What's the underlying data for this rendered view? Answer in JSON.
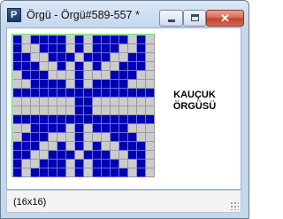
{
  "window": {
    "title": "Örgü - Örgü#589-557 *",
    "app_icon_letter": "P",
    "close_glyph": "✕"
  },
  "canvas": {
    "label_line1": "KAUÇUK",
    "label_line2": "ÖRGÜSÜ",
    "on_color": "#0000b4",
    "off_color": "#cccccc",
    "rows": [
      "1011110101111010",
      "1001110101110010",
      "1100111011100110",
      "1110010101001110",
      "0111000100011100",
      "0011110101111000",
      "1111111111111111",
      "0000000110000000",
      "0000000110000000",
      "1111111111111111",
      "0011110101111000",
      "0111000100011100",
      "1110010101001110",
      "1100111011100110",
      "1001110101110010",
      "1011110101111010"
    ]
  },
  "status": {
    "text": "(16x16)"
  }
}
